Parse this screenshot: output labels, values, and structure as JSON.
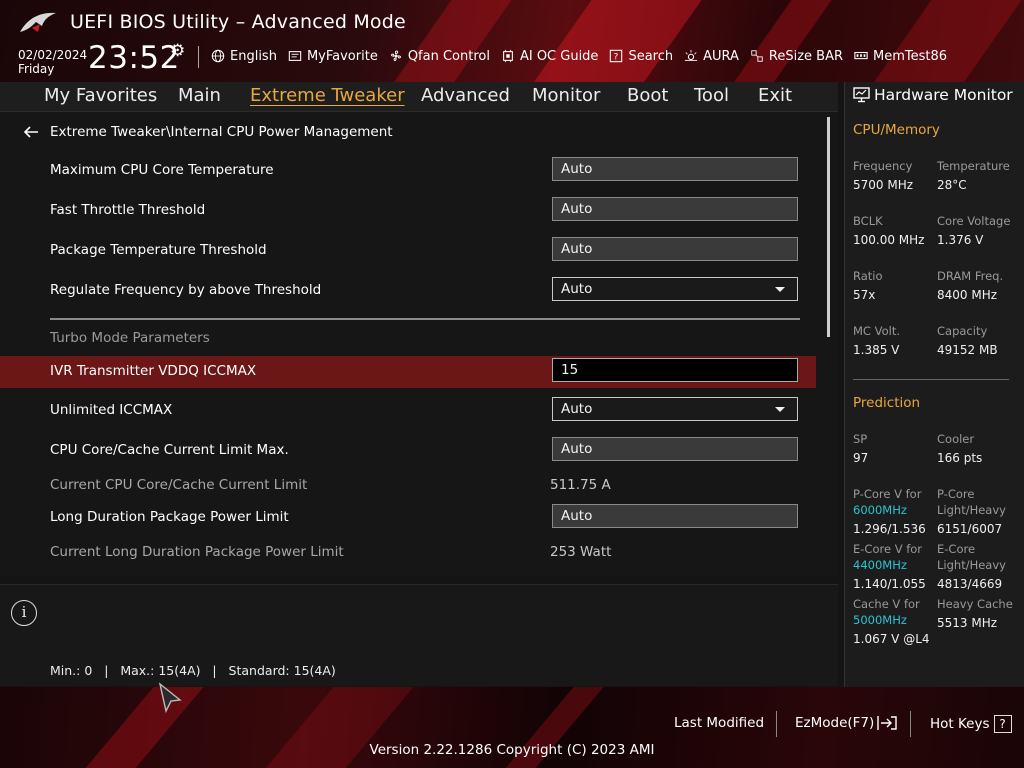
{
  "header": {
    "title": "UEFI BIOS Utility – Advanced Mode",
    "date": "02/02/2024",
    "day": "Friday",
    "time": "23:52",
    "toolbar": [
      {
        "label": "English",
        "icon": "globe-icon"
      },
      {
        "label": "MyFavorite",
        "icon": "favorite-icon"
      },
      {
        "label": "Qfan Control",
        "icon": "fan-icon"
      },
      {
        "label": "AI OC Guide",
        "icon": "ai-icon"
      },
      {
        "label": "Search",
        "icon": "search-icon"
      },
      {
        "label": "AURA",
        "icon": "aura-icon"
      },
      {
        "label": "ReSize BAR",
        "icon": "resize-bar-icon"
      },
      {
        "label": "MemTest86",
        "icon": "memtest-icon"
      }
    ]
  },
  "menu": {
    "items": [
      "My Favorites",
      "Main",
      "Extreme Tweaker",
      "Advanced",
      "Monitor",
      "Boot",
      "Tool",
      "Exit"
    ],
    "active": "Extreme Tweaker"
  },
  "breadcrumb": "Extreme Tweaker\\Internal CPU Power Management",
  "settings": [
    {
      "label": "Maximum CPU Core Temperature",
      "value": "Auto",
      "kind": "field"
    },
    {
      "label": "Fast Throttle Threshold",
      "value": "Auto",
      "kind": "field"
    },
    {
      "label": "Package Temperature Threshold",
      "value": "Auto",
      "kind": "field"
    },
    {
      "label": "Regulate Frequency by above Threshold",
      "value": "Auto",
      "kind": "dropdown"
    },
    {
      "label": "IVR Transmitter VDDQ ICCMAX",
      "value": "15",
      "kind": "edit"
    },
    {
      "label": "Unlimited ICCMAX",
      "value": "Auto",
      "kind": "dropdown"
    },
    {
      "label": "CPU Core/Cache Current Limit Max.",
      "value": "Auto",
      "kind": "field"
    },
    {
      "label": "Current CPU Core/Cache Current Limit",
      "value": "511.75 A",
      "kind": "readonly"
    },
    {
      "label": "Long Duration Package Power Limit",
      "value": "Auto",
      "kind": "field"
    },
    {
      "label": "Current Long Duration Package Power Limit",
      "value": "253 Watt",
      "kind": "readonly"
    }
  ],
  "section_header": "Turbo Mode Parameters",
  "help": {
    "text": "Min.: 0   |   Max.: 15(4A)   |   Standard: 15(4A)"
  },
  "hardware_monitor": {
    "title": "Hardware Monitor",
    "cpu_memory": {
      "heading": "CPU/Memory",
      "frequency_label": "Frequency",
      "frequency": "5700 MHz",
      "temperature_label": "Temperature",
      "temperature": "28°C",
      "bclk_label": "BCLK",
      "bclk": "100.00 MHz",
      "core_voltage_label": "Core Voltage",
      "core_voltage": "1.376 V",
      "ratio_label": "Ratio",
      "ratio": "57x",
      "dram_label": "DRAM Freq.",
      "dram": "8400 MHz",
      "mc_volt_label": "MC Volt.",
      "mc_volt": "1.385 V",
      "capacity_label": "Capacity",
      "capacity": "49152 MB"
    },
    "prediction": {
      "heading": "Prediction",
      "sp_label": "SP",
      "sp": "97",
      "cooler_label": "Cooler",
      "cooler": "166 pts",
      "pcore_v_label": "P-Core V for",
      "pcore_v_freq": "6000MHz",
      "pcore_v": "1.296/1.536",
      "pcore_lh_label1": "P-Core",
      "pcore_lh_label2": "Light/Heavy",
      "pcore_lh": "6151/6007",
      "ecore_v_label": "E-Core V for",
      "ecore_v_freq": "4400MHz",
      "ecore_v": "1.140/1.055",
      "ecore_lh_label1": "E-Core",
      "ecore_lh_label2": "Light/Heavy",
      "ecore_lh": "4813/4669",
      "cache_v_label": "Cache V for",
      "cache_v_freq": "5000MHz",
      "cache_v": "1.067 V @L4",
      "heavy_cache_label": "Heavy Cache",
      "heavy_cache": "5513 MHz"
    }
  },
  "footer": {
    "last_modified": "Last Modified",
    "ezmode": "EzMode(F7)",
    "hotkeys": "Hot Keys",
    "hotkeys_key": "?",
    "version": "Version 2.22.1286 Copyright (C) 2023 AMI"
  },
  "colors": {
    "accent": "#e8a83b",
    "selected_row": "#6b1718",
    "cyan": "#29c4d4"
  }
}
